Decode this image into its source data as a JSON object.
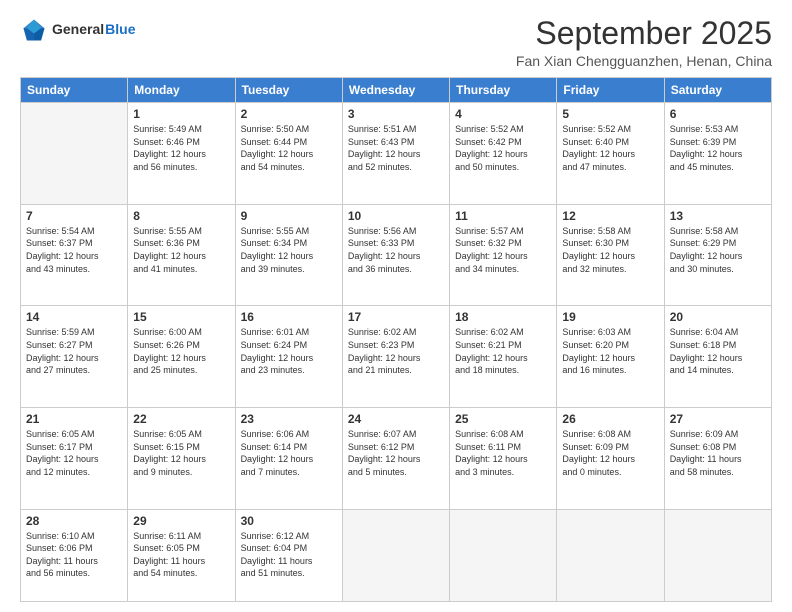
{
  "header": {
    "logo_general": "General",
    "logo_blue": "Blue",
    "month": "September 2025",
    "location": "Fan Xian Chengguanzhen, Henan, China"
  },
  "days_of_week": [
    "Sunday",
    "Monday",
    "Tuesday",
    "Wednesday",
    "Thursday",
    "Friday",
    "Saturday"
  ],
  "weeks": [
    [
      {
        "day": "",
        "empty": true
      },
      {
        "day": "1",
        "sunrise": "5:49 AM",
        "sunset": "6:46 PM",
        "daylight": "12 hours and 56 minutes."
      },
      {
        "day": "2",
        "sunrise": "5:50 AM",
        "sunset": "6:44 PM",
        "daylight": "12 hours and 54 minutes."
      },
      {
        "day": "3",
        "sunrise": "5:51 AM",
        "sunset": "6:43 PM",
        "daylight": "12 hours and 52 minutes."
      },
      {
        "day": "4",
        "sunrise": "5:52 AM",
        "sunset": "6:42 PM",
        "daylight": "12 hours and 50 minutes."
      },
      {
        "day": "5",
        "sunrise": "5:52 AM",
        "sunset": "6:40 PM",
        "daylight": "12 hours and 47 minutes."
      },
      {
        "day": "6",
        "sunrise": "5:53 AM",
        "sunset": "6:39 PM",
        "daylight": "12 hours and 45 minutes."
      }
    ],
    [
      {
        "day": "7",
        "sunrise": "5:54 AM",
        "sunset": "6:37 PM",
        "daylight": "12 hours and 43 minutes."
      },
      {
        "day": "8",
        "sunrise": "5:55 AM",
        "sunset": "6:36 PM",
        "daylight": "12 hours and 41 minutes."
      },
      {
        "day": "9",
        "sunrise": "5:55 AM",
        "sunset": "6:34 PM",
        "daylight": "12 hours and 39 minutes."
      },
      {
        "day": "10",
        "sunrise": "5:56 AM",
        "sunset": "6:33 PM",
        "daylight": "12 hours and 36 minutes."
      },
      {
        "day": "11",
        "sunrise": "5:57 AM",
        "sunset": "6:32 PM",
        "daylight": "12 hours and 34 minutes."
      },
      {
        "day": "12",
        "sunrise": "5:58 AM",
        "sunset": "6:30 PM",
        "daylight": "12 hours and 32 minutes."
      },
      {
        "day": "13",
        "sunrise": "5:58 AM",
        "sunset": "6:29 PM",
        "daylight": "12 hours and 30 minutes."
      }
    ],
    [
      {
        "day": "14",
        "sunrise": "5:59 AM",
        "sunset": "6:27 PM",
        "daylight": "12 hours and 27 minutes."
      },
      {
        "day": "15",
        "sunrise": "6:00 AM",
        "sunset": "6:26 PM",
        "daylight": "12 hours and 25 minutes."
      },
      {
        "day": "16",
        "sunrise": "6:01 AM",
        "sunset": "6:24 PM",
        "daylight": "12 hours and 23 minutes."
      },
      {
        "day": "17",
        "sunrise": "6:02 AM",
        "sunset": "6:23 PM",
        "daylight": "12 hours and 21 minutes."
      },
      {
        "day": "18",
        "sunrise": "6:02 AM",
        "sunset": "6:21 PM",
        "daylight": "12 hours and 18 minutes."
      },
      {
        "day": "19",
        "sunrise": "6:03 AM",
        "sunset": "6:20 PM",
        "daylight": "12 hours and 16 minutes."
      },
      {
        "day": "20",
        "sunrise": "6:04 AM",
        "sunset": "6:18 PM",
        "daylight": "12 hours and 14 minutes."
      }
    ],
    [
      {
        "day": "21",
        "sunrise": "6:05 AM",
        "sunset": "6:17 PM",
        "daylight": "12 hours and 12 minutes."
      },
      {
        "day": "22",
        "sunrise": "6:05 AM",
        "sunset": "6:15 PM",
        "daylight": "12 hours and 9 minutes."
      },
      {
        "day": "23",
        "sunrise": "6:06 AM",
        "sunset": "6:14 PM",
        "daylight": "12 hours and 7 minutes."
      },
      {
        "day": "24",
        "sunrise": "6:07 AM",
        "sunset": "6:12 PM",
        "daylight": "12 hours and 5 minutes."
      },
      {
        "day": "25",
        "sunrise": "6:08 AM",
        "sunset": "6:11 PM",
        "daylight": "12 hours and 3 minutes."
      },
      {
        "day": "26",
        "sunrise": "6:08 AM",
        "sunset": "6:09 PM",
        "daylight": "12 hours and 0 minutes."
      },
      {
        "day": "27",
        "sunrise": "6:09 AM",
        "sunset": "6:08 PM",
        "daylight": "11 hours and 58 minutes."
      }
    ],
    [
      {
        "day": "28",
        "sunrise": "6:10 AM",
        "sunset": "6:06 PM",
        "daylight": "11 hours and 56 minutes."
      },
      {
        "day": "29",
        "sunrise": "6:11 AM",
        "sunset": "6:05 PM",
        "daylight": "11 hours and 54 minutes."
      },
      {
        "day": "30",
        "sunrise": "6:12 AM",
        "sunset": "6:04 PM",
        "daylight": "11 hours and 51 minutes."
      },
      {
        "day": "",
        "empty": true
      },
      {
        "day": "",
        "empty": true
      },
      {
        "day": "",
        "empty": true
      },
      {
        "day": "",
        "empty": true
      }
    ]
  ]
}
